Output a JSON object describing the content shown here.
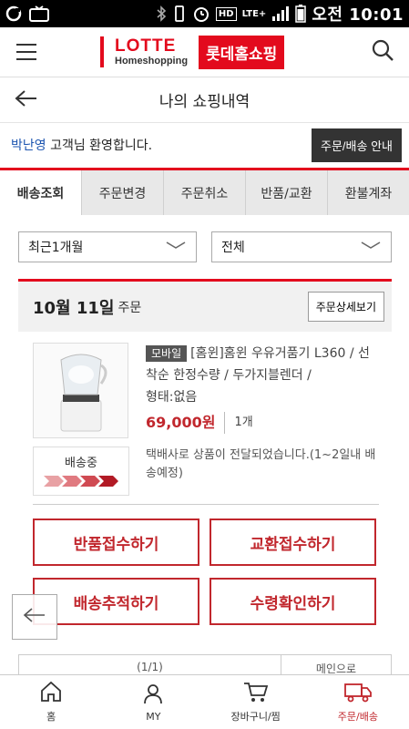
{
  "status_bar": {
    "clock": "오전 10:01",
    "network_label": "LTE+",
    "hd_label": "HD"
  },
  "header": {
    "logo_en_line1": "LOTTE",
    "logo_en_line2": "Homeshopping",
    "logo_kr": "롯데홈쇼핑"
  },
  "page": {
    "title": "나의 쇼핑내역"
  },
  "welcome": {
    "user_name": "박난영",
    "message": " 고객님 환영합니다.",
    "guide_button": "주문/배송 안내"
  },
  "tabs": [
    {
      "label": "배송조회",
      "active": true
    },
    {
      "label": "주문변경",
      "active": false
    },
    {
      "label": "주문취소",
      "active": false
    },
    {
      "label": "반품/교환",
      "active": false
    },
    {
      "label": "환불계좌",
      "active": false
    }
  ],
  "filters": {
    "period": "최근1개월",
    "status": "전체"
  },
  "order": {
    "date": "10월 11일",
    "date_suffix": "주문",
    "detail_button": "주문상세보기",
    "product": {
      "badge": "모바일",
      "name": "[홈윈]홈윈 우유거품기 L360 / 선착순 한정수량 / 두가지블렌더 /",
      "option": "형태:없음",
      "price": "69,000원",
      "quantity": "1개"
    },
    "shipping": {
      "status": "배송중",
      "progress_steps": 4,
      "progress_current": 4,
      "message": "택배사로 상품이 전달되었습니다.(1~2일내 배송예정)"
    },
    "actions": {
      "return": "반품접수하기",
      "exchange": "교환접수하기",
      "track": "배송추적하기",
      "confirm": "수령확인하기"
    }
  },
  "pager": {
    "page_text": "(1/1)",
    "main_text": "메인으로"
  },
  "bottom_nav": [
    {
      "label": "홈",
      "icon": "home-icon",
      "active": false
    },
    {
      "label": "MY",
      "icon": "user-icon",
      "active": false
    },
    {
      "label": "장바구니/찜",
      "icon": "cart-icon",
      "active": false
    },
    {
      "label": "주문/배송",
      "icon": "truck-icon",
      "active": true
    }
  ],
  "colors": {
    "brand_red": "#e30a1d",
    "price_red": "#c1272d",
    "user_blue": "#1d55b0"
  }
}
